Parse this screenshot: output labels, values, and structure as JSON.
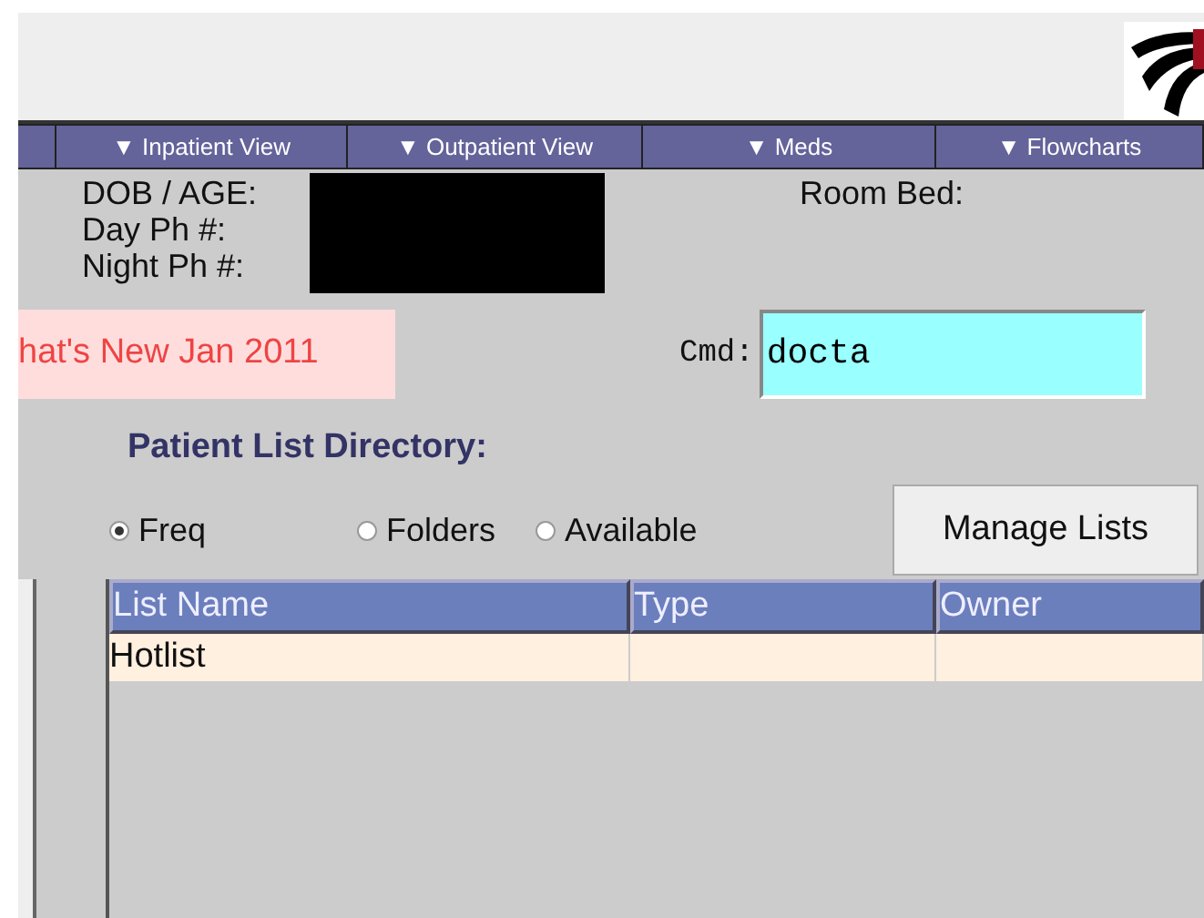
{
  "nav_tabs": [
    {
      "label": "▼ Inpatient View"
    },
    {
      "label": "▼ Outpatient View"
    },
    {
      "label": "▼ Meds"
    },
    {
      "label": "▼ Flowcharts"
    }
  ],
  "patient_info": {
    "labels": [
      "DOB / AGE:",
      "Day Ph #:",
      "Night Ph #:"
    ],
    "room_label": "Room Bed:"
  },
  "banner": "hat's New Jan 2011",
  "command": {
    "label": "Cmd:",
    "value": "docta"
  },
  "directory": {
    "title": "Patient List Directory:",
    "options": [
      {
        "label": "Freq",
        "selected": true
      },
      {
        "label": "Folders",
        "selected": false
      },
      {
        "label": "Available",
        "selected": false
      }
    ],
    "button": "Manage Lists"
  },
  "table": {
    "columns": [
      "List Name",
      "Type",
      "Owner"
    ],
    "rows": [
      [
        "Hotlist",
        "",
        ""
      ]
    ]
  }
}
